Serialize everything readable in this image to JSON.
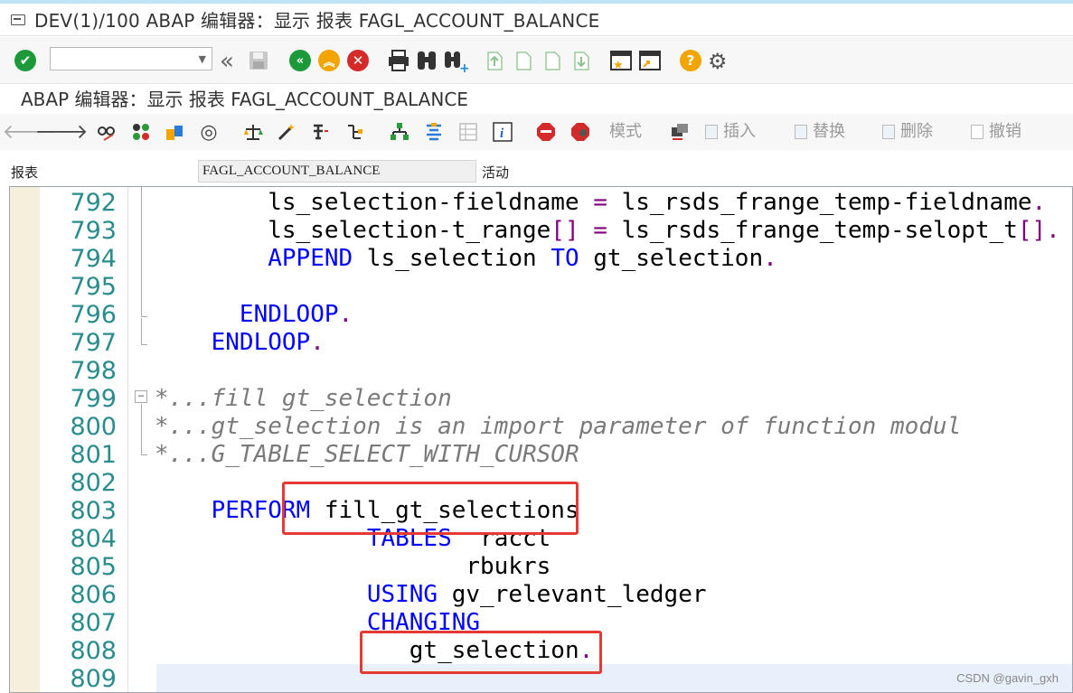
{
  "window": {
    "title": "DEV(1)/100 ABAP 编辑器：显示 报表 FAGL_ACCOUNT_BALANCE"
  },
  "subtitle": "ABAP 编辑器：显示 报表 FAGL_ACCOUNT_BALANCE",
  "command_field": {
    "value": ""
  },
  "toolbar2": {
    "mode_label": "模式",
    "insert_label": "插入",
    "replace_label": "替换",
    "delete_label": "删除",
    "undo_label": "撤销"
  },
  "report_row": {
    "label": "报表",
    "value": "FAGL_ACCOUNT_BALANCE",
    "status": "活动"
  },
  "code_lines": [
    {
      "num": "792",
      "tokens": [
        [
          "tx",
          "        ls_selection-fieldname "
        ],
        [
          "pt",
          "="
        ],
        [
          "tx",
          " ls_rsds_frange_temp-fieldname"
        ],
        [
          "pt",
          "."
        ]
      ]
    },
    {
      "num": "793",
      "tokens": [
        [
          "tx",
          "        ls_selection-t_range"
        ],
        [
          "pt",
          "[]"
        ],
        [
          "tx",
          " "
        ],
        [
          "pt",
          "="
        ],
        [
          "tx",
          " ls_rsds_frange_temp-selopt_t"
        ],
        [
          "pt",
          "[]."
        ]
      ]
    },
    {
      "num": "794",
      "tokens": [
        [
          "tx",
          "        "
        ],
        [
          "kw",
          "APPEND"
        ],
        [
          "tx",
          " ls_selection "
        ],
        [
          "kw",
          "TO"
        ],
        [
          "tx",
          " gt_selection"
        ],
        [
          "pt",
          "."
        ]
      ]
    },
    {
      "num": "795",
      "tokens": []
    },
    {
      "num": "796",
      "tokens": [
        [
          "tx",
          "      "
        ],
        [
          "kw",
          "ENDLOOP"
        ],
        [
          "pt",
          "."
        ]
      ]
    },
    {
      "num": "797",
      "tokens": [
        [
          "tx",
          "    "
        ],
        [
          "kw",
          "ENDLOOP"
        ],
        [
          "pt",
          "."
        ]
      ]
    },
    {
      "num": "798",
      "tokens": []
    },
    {
      "num": "799",
      "tokens": [
        [
          "cm",
          "*...fill gt_selection"
        ]
      ]
    },
    {
      "num": "800",
      "tokens": [
        [
          "cm",
          "*...gt_selection is an import parameter of function modul"
        ]
      ]
    },
    {
      "num": "801",
      "tokens": [
        [
          "cm",
          "*...G_TABLE_SELECT_WITH_CURSOR"
        ]
      ]
    },
    {
      "num": "802",
      "tokens": []
    },
    {
      "num": "803",
      "tokens": [
        [
          "tx",
          "    "
        ],
        [
          "kw",
          "PERFORM"
        ],
        [
          "tx",
          " fill_gt_selections"
        ]
      ]
    },
    {
      "num": "804",
      "tokens": [
        [
          "tx",
          "               "
        ],
        [
          "kw",
          "TABLES"
        ],
        [
          "tx",
          "  racct"
        ]
      ]
    },
    {
      "num": "805",
      "tokens": [
        [
          "tx",
          "                      rbukrs"
        ]
      ]
    },
    {
      "num": "806",
      "tokens": [
        [
          "tx",
          "               "
        ],
        [
          "kw",
          "USING"
        ],
        [
          "tx",
          " gv_relevant_ledger"
        ]
      ]
    },
    {
      "num": "807",
      "tokens": [
        [
          "tx",
          "               "
        ],
        [
          "kw",
          "CHANGING"
        ]
      ]
    },
    {
      "num": "808",
      "tokens": [
        [
          "tx",
          "                  gt_selection"
        ],
        [
          "pt",
          "."
        ]
      ]
    },
    {
      "num": "809",
      "tokens": []
    }
  ],
  "watermark": "CSDN @gavin_gxh",
  "colors": {
    "keyword": "#0000ff",
    "comment": "#7a7a7a",
    "line_number": "#2b8c8c",
    "highlight_box": "#e53935"
  }
}
